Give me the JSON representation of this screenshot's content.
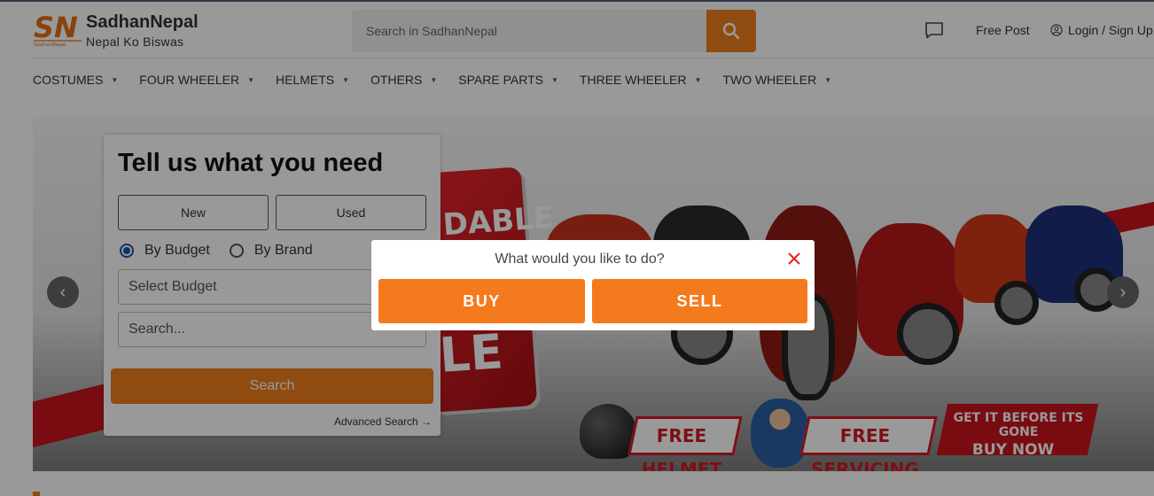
{
  "brand": {
    "logo_text": "SN",
    "logo_subtext": "SadhanNepal",
    "name": "SadhanNepal",
    "tagline": "Nepal Ko Biswas"
  },
  "search": {
    "placeholder": "Search in SadhanNepal"
  },
  "header_links": {
    "free_post": "Free Post",
    "login": "Login / Sign Up"
  },
  "nav": {
    "items": [
      {
        "label": "COSTUMES"
      },
      {
        "label": "FOUR WHEELER"
      },
      {
        "label": "HELMETS"
      },
      {
        "label": "OTHERS"
      },
      {
        "label": "SPARE PARTS"
      },
      {
        "label": "THREE WHEELER"
      },
      {
        "label": "TWO WHEELER"
      }
    ]
  },
  "banner": {
    "panel_top": "DABLE",
    "panel_bottom": "LE",
    "promo_helmet": "FREE HELMET",
    "promo_servicing": "FREE SERVICING",
    "promo_cta_line1": "GET IT BEFORE ITS GONE",
    "promo_cta_line2": "BUY NOW"
  },
  "search_card": {
    "title": "Tell us what you need",
    "new_label": "New",
    "used_label": "Used",
    "by_budget": "By Budget",
    "by_brand": "By Brand",
    "budget_placeholder": "Select Budget",
    "search_placeholder": "Search...",
    "search_button": "Search",
    "advanced_link": "Advanced Search"
  },
  "modal": {
    "question": "What would you like to do?",
    "buy": "BUY",
    "sell": "SELL"
  },
  "colors": {
    "accent": "#ef7d1b",
    "modal_button": "#f47a1d",
    "close": "#e0261c",
    "banner_red": "#c8141c"
  }
}
